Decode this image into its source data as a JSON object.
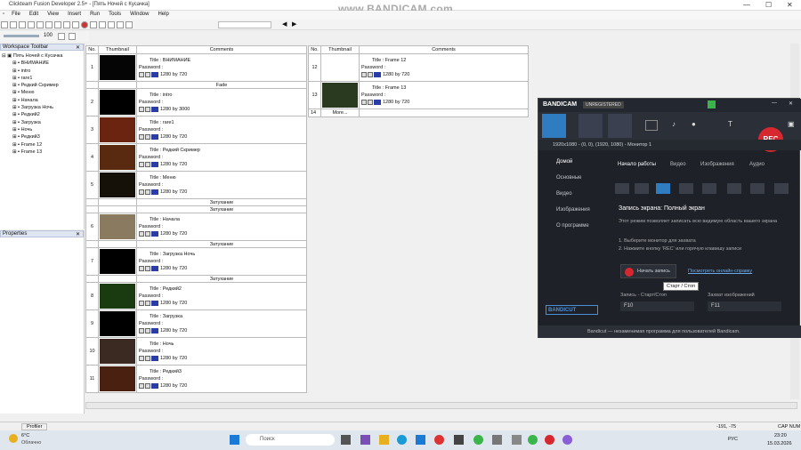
{
  "window": {
    "title": "Clickteam Fusion Developer 2.5+ - [Пять Ночей с Кусачка]"
  },
  "watermark": "www.BANDICAM.com",
  "menu": [
    "File",
    "Edit",
    "View",
    "Insert",
    "Run",
    "Tools",
    "Window",
    "Help"
  ],
  "zoom": "100",
  "workspace": {
    "title": "Workspace Toolbar",
    "root": "Пять Ночей с Кусачка",
    "frames": [
      "ВНИМАНИЕ",
      "intro",
      "rare1",
      "Редкий Скример",
      "Меню",
      "Начала",
      "Загрузка Ночь",
      "Редкий2",
      "Загрузка",
      "Ночь",
      "Редкий3",
      "Frame 12",
      "Frame 13"
    ]
  },
  "properties": {
    "title": "Properties"
  },
  "grid": {
    "col_no": "No.",
    "col_thumb": "Thumbnail",
    "col_comments": "Comments",
    "title_prefix": "Title : ",
    "password_label": "Password :",
    "size": "1280 by 720"
  },
  "rows_left": [
    {
      "no": "1",
      "title": "ВНИМАНИЕ",
      "size": "1280 by 720",
      "thumb": "#050505"
    },
    {
      "trans": "Fade"
    },
    {
      "no": "2",
      "title": "intro",
      "size": "1280 by 3000",
      "thumb": "#000000"
    },
    {
      "no": "3",
      "title": "rare1",
      "size": "1280 by 720",
      "thumb": "#6b2410"
    },
    {
      "no": "4",
      "title": "Редкий Скример",
      "size": "1280 by 720",
      "thumb": "#5a2a10"
    },
    {
      "no": "5",
      "title": "Меню",
      "size": "1280 by 720",
      "thumb": "#151008"
    },
    {
      "trans": "Затухание"
    },
    {
      "trans": "Затухание"
    },
    {
      "no": "6",
      "title": "Начала",
      "size": "1280 by 720",
      "thumb": "#8a7a60"
    },
    {
      "trans": "Затухание"
    },
    {
      "no": "7",
      "title": "Загрузка Ночь",
      "size": "1280 by 720",
      "thumb": "#000000"
    },
    {
      "trans": "Затухание"
    },
    {
      "no": "8",
      "title": "Редкий2",
      "size": "1280 by 720",
      "thumb": "#1a3a10"
    },
    {
      "no": "9",
      "title": "Загрузка",
      "size": "1280 by 720",
      "thumb": "#000000"
    },
    {
      "no": "10",
      "title": "Ночь",
      "size": "1280 by 720",
      "thumb": "#3a2a22"
    },
    {
      "no": "11",
      "title": "Редкий3",
      "size": "1280 by 720",
      "thumb": "#4a2010"
    }
  ],
  "rows_right": [
    {
      "no": "12",
      "title": "Frame 12",
      "size": "1280 by 720",
      "thumb": "#ffffff"
    },
    {
      "no": "13",
      "title": "Frame 13",
      "size": "1280 by 720",
      "thumb": "#2a3a20"
    },
    {
      "no": "14",
      "more": "More..."
    }
  ],
  "bandicam": {
    "logo": "BANDICAM",
    "badge": "UNREGISTERED",
    "resolution": "1920x1080 - (0, 0), (1920, 1080) - Монитор 1",
    "rec": "REC",
    "nav": [
      "Домой",
      "Основные",
      "Видео",
      "Изображения",
      "О программе"
    ],
    "tabs": [
      "Начало работы",
      "Видео",
      "Изображения",
      "Аудио"
    ],
    "heading": "Запись экрана: Полный экран",
    "desc": "Этот режим позволяет записать всю видимую область вашего экрана",
    "step1": "1. Выберите монитор для захвата",
    "step2": "2. Нажмите кнопку 'REC' или горячую клавишу записи",
    "start_btn": "Начать запись",
    "help_link": "Посмотреть онлайн-справку",
    "hotkey1_label": "Запись - Старт/Стоп",
    "hotkey1": "F10",
    "hotkey2_label": "Захват изображений",
    "hotkey2": "F11",
    "bandicut": "BANDICUT",
    "footer": "Bandicut — незаменимая программа для пользователей Bandicam.",
    "tooltip": "Старт / Стоп"
  },
  "status": {
    "coords": "-191, -75",
    "caps": "CAP NUM",
    "profiler": "Profiler"
  },
  "taskbar": {
    "temp": "6°C",
    "weather": "Облачно",
    "search": "Поиск",
    "lang": "РУС",
    "time": "23:20",
    "date": "15.03.2026"
  }
}
